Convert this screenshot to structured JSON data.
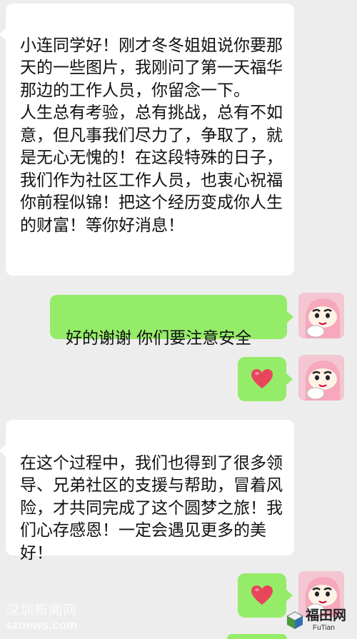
{
  "messages": [
    {
      "side": "received",
      "text": "小连同学好！刚才冬冬姐姐说你要那天的一些图片，我刚问了第一天福华那边的工作人员，你留念一下。\n人生总有考验，总有挑战，总有不如意，但凡事我们尽力了，争取了，就是无心无愧的！在这段特殊的日子，我们作为社区工作人员，也衷心祝福你前程似锦！把这个经历变成你人生的财富！等你好消息！"
    },
    {
      "side": "sent",
      "text": "好的谢谢 你们要注意安全"
    },
    {
      "side": "sent",
      "sticker": "heart"
    },
    {
      "side": "received",
      "text": "在这个过程中，我们也得到了很多领导、兄弟社区的支援与帮助，冒着风险，才共同完成了这个圆梦之旅！我们心存感恩！一定会遇见更多的美好！"
    },
    {
      "side": "sent",
      "sticker": "heart"
    }
  ],
  "colors": {
    "background": "#ededed",
    "received_bubble": "#ffffff",
    "sent_bubble": "#95ec69",
    "heart": "#e8455a"
  },
  "watermarks": {
    "left_cn": "深圳新闻网",
    "left_en": "sznews.com",
    "right_cn": "福田网",
    "right_en": "FuTian"
  }
}
